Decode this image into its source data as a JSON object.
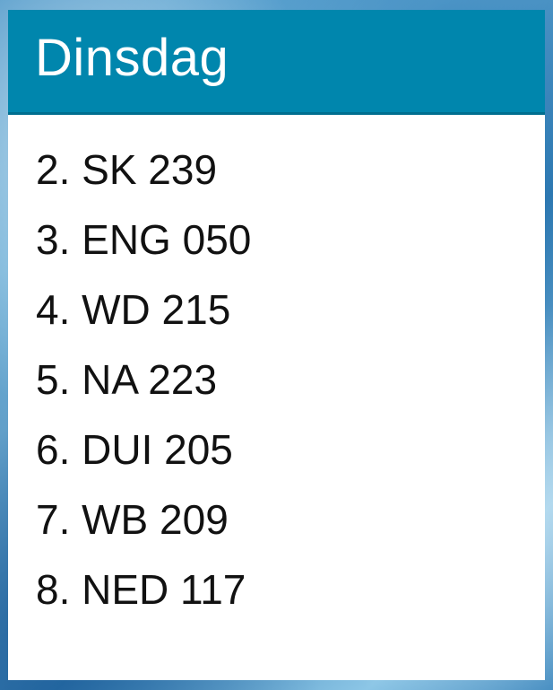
{
  "widget": {
    "title": "Dinsdag",
    "header_color": "#0086ad",
    "items": [
      {
        "label": "2. SK 239"
      },
      {
        "label": "3. ENG 050"
      },
      {
        "label": "4. WD 215"
      },
      {
        "label": "5. NA 223"
      },
      {
        "label": "6. DUI 205"
      },
      {
        "label": "7. WB 209"
      },
      {
        "label": "8. NED 117"
      }
    ]
  }
}
